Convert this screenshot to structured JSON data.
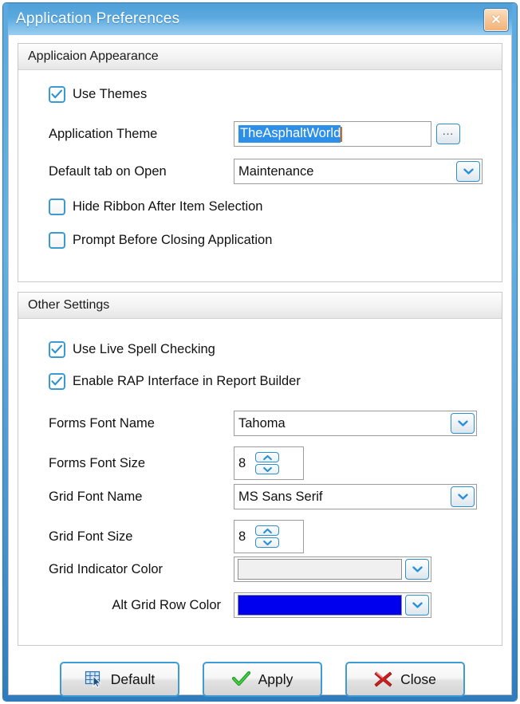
{
  "window": {
    "title": "Application Preferences",
    "close_icon": "close-x-icon",
    "accent_color": "#4f9fd9",
    "close_button_color": "#f2b176"
  },
  "groups": [
    {
      "header": "Applicaion Appearance",
      "fields": {
        "use_themes": {
          "label": "Use Themes",
          "checked": true
        },
        "application_theme": {
          "label": "Application Theme",
          "value": "TheAsphaltWorld",
          "selected": true,
          "browse_icon": "ellipsis-icon"
        },
        "default_tab": {
          "label": "Default tab on Open",
          "value": "Maintenance",
          "dropdown_icon": "chevron-down-icon"
        },
        "hide_ribbon": {
          "label": "Hide Ribbon After Item Selection",
          "checked": false
        },
        "prompt_before_closing": {
          "label": "Prompt Before Closing Application",
          "checked": false
        }
      }
    },
    {
      "header": "Other Settings",
      "fields": {
        "live_spell": {
          "label": "Use Live Spell Checking",
          "checked": true
        },
        "rap_interface": {
          "label": "Enable RAP Interface in Report Builder",
          "checked": true
        },
        "forms_font_name": {
          "label": "Forms Font Name",
          "value": "Tahoma",
          "dropdown_icon": "chevron-down-icon"
        },
        "forms_font_size": {
          "label": "Forms Font Size",
          "value": "8",
          "up_icon": "chevron-up-icon",
          "down_icon": "chevron-down-icon"
        },
        "grid_font_name": {
          "label": "Grid Font Name",
          "value": "MS Sans Serif",
          "dropdown_icon": "chevron-down-icon"
        },
        "grid_font_size": {
          "label": "Grid Font Size",
          "value": "8",
          "up_icon": "chevron-up-icon",
          "down_icon": "chevron-down-icon"
        },
        "grid_indicator_color": {
          "label": "Grid Indicator Color",
          "color": "#f0f0f0",
          "dropdown_icon": "chevron-down-icon"
        },
        "alt_grid_row_color": {
          "label": "Alt Grid Row Color",
          "color": "#0000ee",
          "dropdown_icon": "chevron-down-icon"
        }
      }
    }
  ],
  "buttons": {
    "default": {
      "label": "Default",
      "icon": "grid-cursor-icon"
    },
    "apply": {
      "label": "Apply",
      "icon": "green-check-icon"
    },
    "close": {
      "label": "Close",
      "icon": "red-x-icon"
    }
  }
}
